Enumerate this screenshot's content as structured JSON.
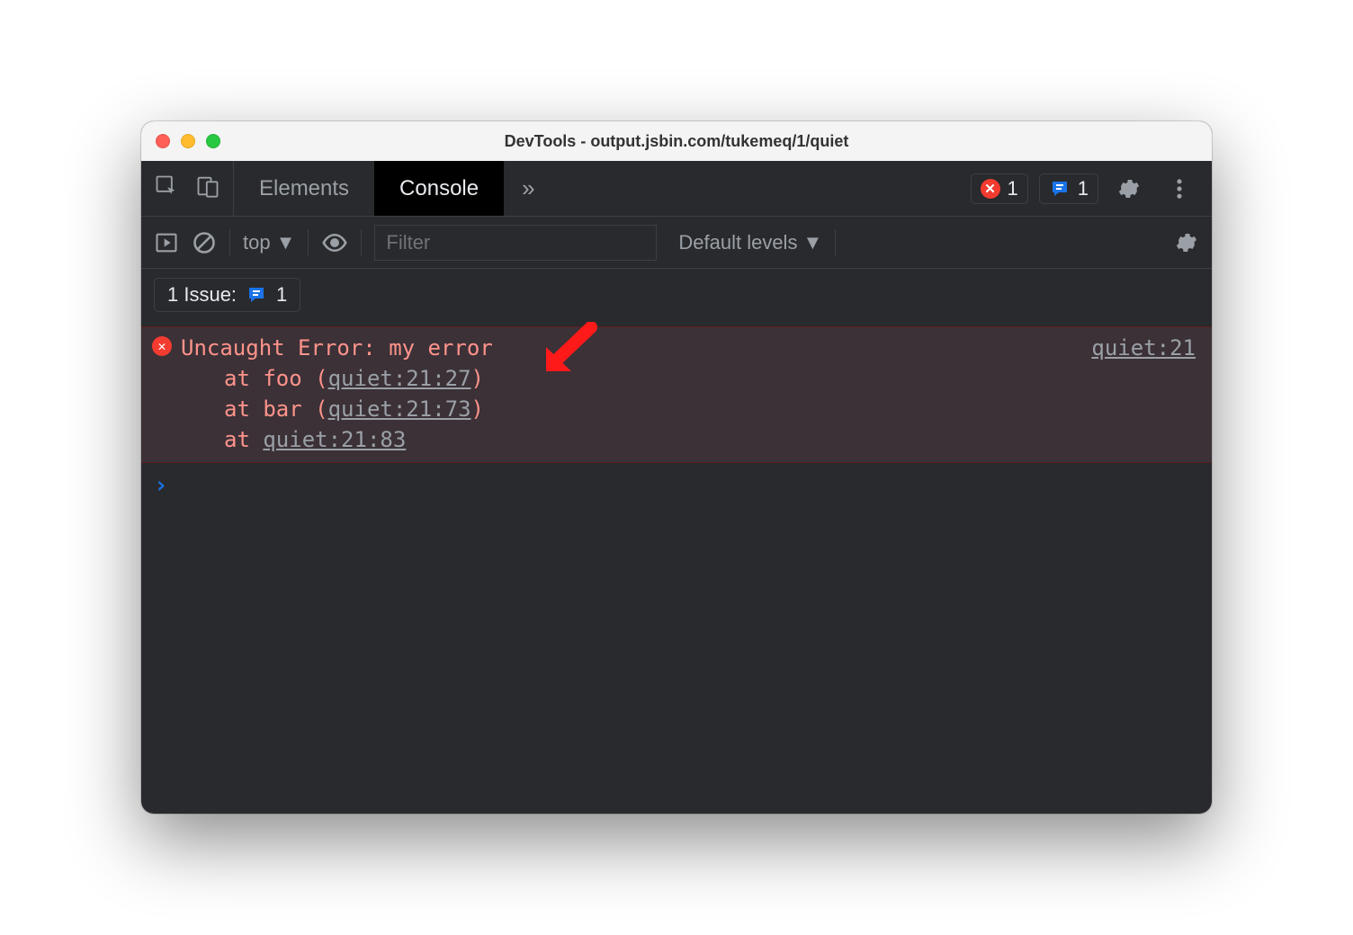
{
  "window": {
    "title": "DevTools - output.jsbin.com/tukemeq/1/quiet"
  },
  "tabs": {
    "elements_label": "Elements",
    "console_label": "Console"
  },
  "badges": {
    "error_count": "1",
    "issue_count_top": "1"
  },
  "console_toolbar": {
    "context": "top",
    "filter_placeholder": "Filter",
    "levels_label": "Default levels"
  },
  "issues": {
    "label": "1 Issue:",
    "count": "1"
  },
  "error": {
    "message": "Uncaught Error: my error",
    "source_link": "quiet:21",
    "stack": [
      {
        "prefix": "at foo (",
        "link": "quiet:21:27",
        "suffix": ")"
      },
      {
        "prefix": "at bar (",
        "link": "quiet:21:73",
        "suffix": ")"
      },
      {
        "prefix": "at ",
        "link": "quiet:21:83",
        "suffix": ""
      }
    ]
  }
}
